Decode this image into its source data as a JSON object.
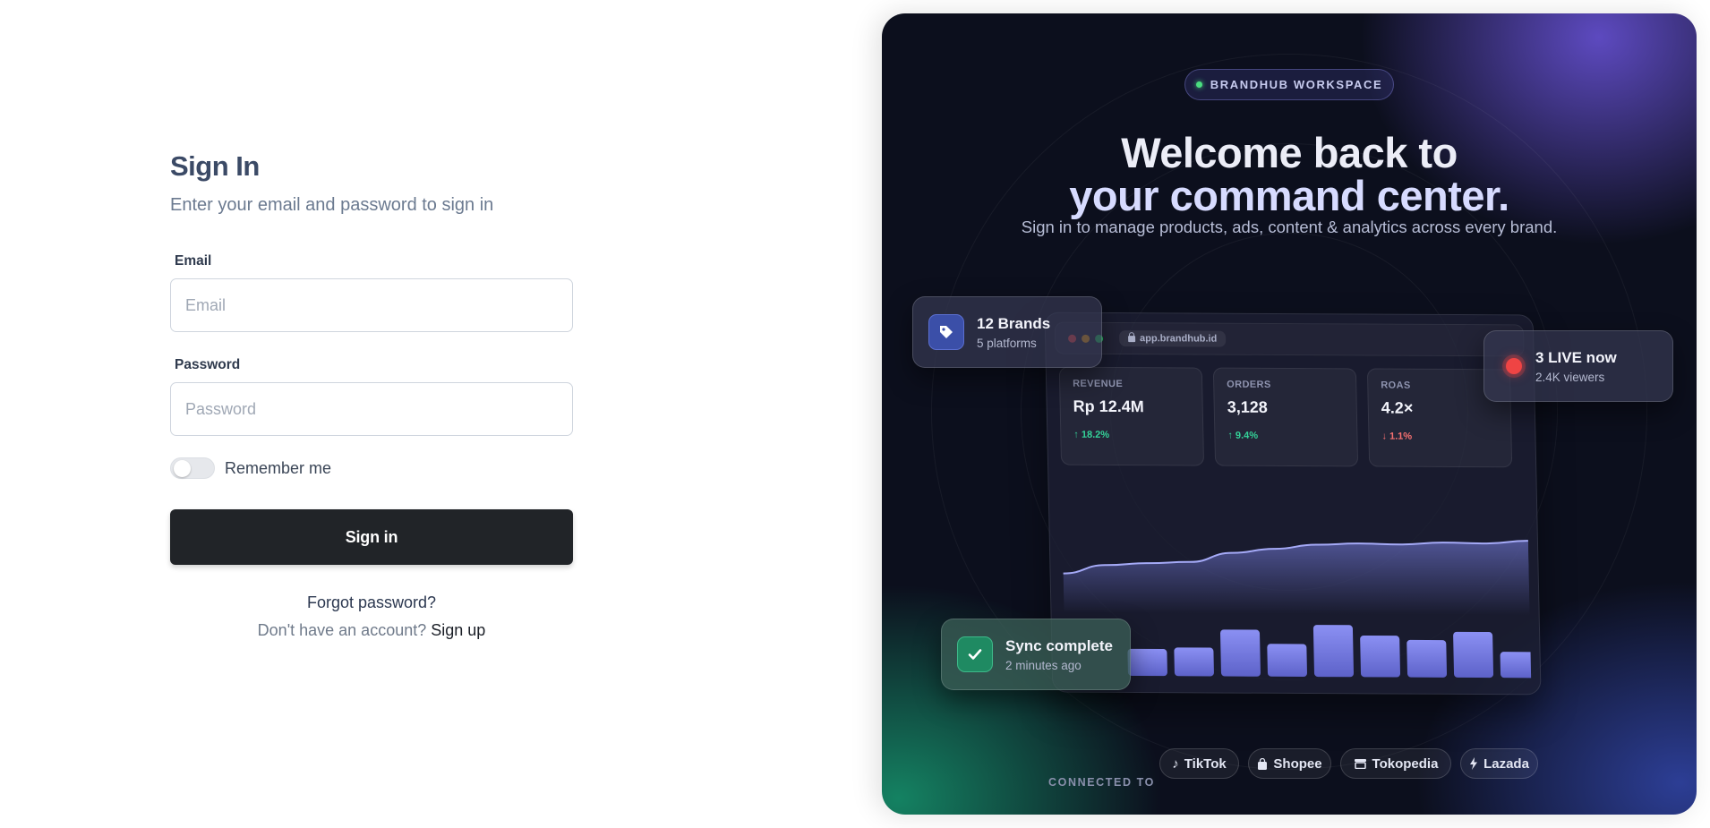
{
  "signin": {
    "title": "Sign In",
    "subtitle": "Enter your email and password to sign in",
    "email_label": "Email",
    "email_placeholder": "Email",
    "email_value": "",
    "password_label": "Password",
    "password_placeholder": "Password",
    "password_value": "",
    "remember_label": "Remember me",
    "remember_checked": false,
    "submit_label": "Sign in",
    "forgot_label": "Forgot password?",
    "no_account_text": "Don't have an account?",
    "signup_label": "Sign up"
  },
  "panel": {
    "badge": "BRANDHUB WORKSPACE",
    "headline_line1": "Welcome back to",
    "headline_line2": "your command center.",
    "subtitle": "Sign in to manage products, ads, content & analytics across every brand.",
    "dashboard": {
      "url": "app.brandhub.id",
      "stats": [
        {
          "label": "REVENUE",
          "value": "Rp 12.4M",
          "delta": "18.2%",
          "direction": "up"
        },
        {
          "label": "ORDERS",
          "value": "3,128",
          "delta": "9.4%",
          "direction": "up"
        },
        {
          "label": "ROAS",
          "value": "4.2×",
          "delta": "1.1%",
          "direction": "down"
        }
      ],
      "trend_line": [
        30,
        42,
        45,
        47,
        60,
        66,
        72,
        74,
        73,
        76,
        75,
        79
      ],
      "bar_levels": [
        0.52,
        0.55,
        0.9,
        0.63,
        1.0,
        0.8,
        0.72,
        0.88,
        0.5
      ]
    },
    "card_brands": {
      "title": "12 Brands",
      "subtitle": "5 platforms",
      "icon": "tag-icon"
    },
    "card_live": {
      "title": "3 LIVE now",
      "subtitle": "2.4K viewers"
    },
    "card_sync": {
      "title": "Sync complete",
      "subtitle": "2 minutes ago",
      "icon": "check-icon"
    },
    "connected_label": "CONNECTED TO",
    "platforms": [
      {
        "name": "TikTok",
        "icon": "tiktok-icon"
      },
      {
        "name": "Shopee",
        "icon": "bag-icon"
      },
      {
        "name": "Tokopedia",
        "icon": "store-icon"
      },
      {
        "name": "Lazada",
        "icon": "bolt-icon"
      }
    ]
  },
  "colors": {
    "primary_button": "#212428",
    "accent_purple": "#6b54dc",
    "accent_green": "#34d399",
    "negative_red": "#f87171",
    "live_red": "#ef4444"
  }
}
